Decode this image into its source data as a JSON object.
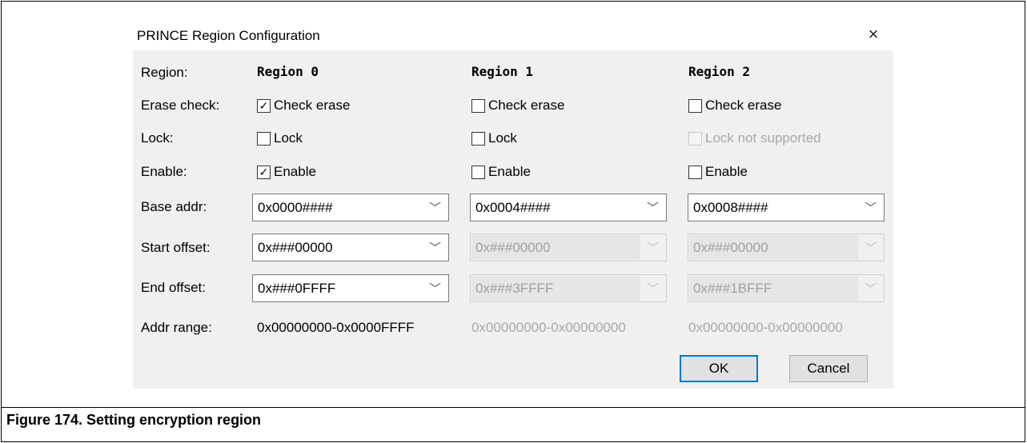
{
  "dialog": {
    "title": "PRINCE Region Configuration",
    "close_glyph": "×",
    "labels": {
      "region": "Region:",
      "erase_check": "Erase check:",
      "lock": "Lock:",
      "enable": "Enable:",
      "base_addr": "Base addr:",
      "start_offset": "Start offset:",
      "end_offset": "End offset:",
      "addr_range": "Addr range:"
    },
    "regions": [
      {
        "name": "Region 0",
        "erase_label": "Check erase",
        "erase_checked": true,
        "lock_label": "Lock",
        "lock_checked": false,
        "lock_enabled": true,
        "enable_label": "Enable",
        "enable_checked": true,
        "base_addr": "0x0000####",
        "start_offset": "0x###00000",
        "start_enabled": true,
        "end_offset": "0x###0FFFF",
        "end_enabled": true,
        "addr_range": "0x00000000-0x0000FFFF",
        "range_enabled": true
      },
      {
        "name": "Region 1",
        "erase_label": "Check erase",
        "erase_checked": false,
        "lock_label": "Lock",
        "lock_checked": false,
        "lock_enabled": true,
        "enable_label": "Enable",
        "enable_checked": false,
        "base_addr": "0x0004####",
        "start_offset": "0x###00000",
        "start_enabled": false,
        "end_offset": "0x###3FFFF",
        "end_enabled": false,
        "addr_range": "0x00000000-0x00000000",
        "range_enabled": false
      },
      {
        "name": "Region 2",
        "erase_label": "Check erase",
        "erase_checked": false,
        "lock_label": "Lock not supported",
        "lock_checked": false,
        "lock_enabled": false,
        "enable_label": "Enable",
        "enable_checked": false,
        "base_addr": "0x0008####",
        "start_offset": "0x###00000",
        "start_enabled": false,
        "end_offset": "0x###1BFFF",
        "end_enabled": false,
        "addr_range": "0x00000000-0x00000000",
        "range_enabled": false
      }
    ],
    "buttons": {
      "ok": "OK",
      "cancel": "Cancel"
    },
    "colors": {
      "dialog_bg": "#f0f0f0",
      "focus_border": "#0078d7",
      "disabled_text": "#a8a8a8"
    }
  },
  "caption": "Figure 174. Setting encryption region",
  "icons": {
    "checkmark": "✓",
    "dropdown": "﹀"
  }
}
